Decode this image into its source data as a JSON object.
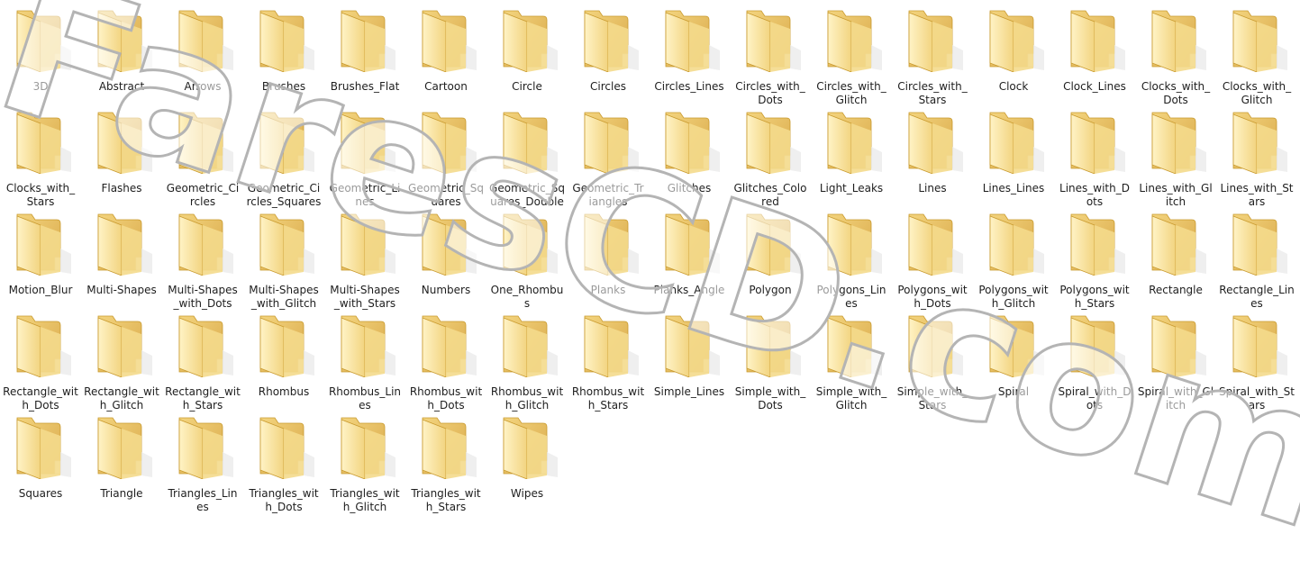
{
  "folders": [
    "3D",
    "Abstract",
    "Arrows",
    "Brushes",
    "Brushes_Flat",
    "Cartoon",
    "Circle",
    "Circles",
    "Circles_Lines",
    "Circles_with_\nDots",
    "Circles_with_\nGlitch",
    "Circles_with_\nStars",
    "Clock",
    "Clock_Lines",
    "Clocks_with_\nDots",
    "Clocks_with_\nGlitch",
    "Clocks_with_\nStars",
    "Flashes",
    "Geometric_Ci\nrcles",
    "Geometric_Ci\nrcles_Squares",
    "Geometric_Li\nnes",
    "Geometric_Sq\nuares",
    "Geometric_Sq\nuares_Double",
    "Geometric_Tr\niangles",
    "Glitches",
    "Glitches_Colo\nred",
    "Light_Leaks",
    "Lines",
    "Lines_Lines",
    "Lines_with_D\nots",
    "Lines_with_Gl\nitch",
    "Lines_with_St\nars",
    "Motion_Blur",
    "Multi-Shapes",
    "Multi-Shapes\n_with_Dots",
    "Multi-Shapes\n_with_Glitch",
    "Multi-Shapes\n_with_Stars",
    "Numbers",
    "One_Rhombu\ns",
    "Planks",
    "Planks_Angle",
    "Polygon",
    "Polygons_Lin\nes",
    "Polygons_wit\nh_Dots",
    "Polygons_wit\nh_Glitch",
    "Polygons_wit\nh_Stars",
    "Rectangle",
    "Rectangle_Lin\nes",
    "Rectangle_wit\nh_Dots",
    "Rectangle_wit\nh_Glitch",
    "Rectangle_wit\nh_Stars",
    "Rhombus",
    "Rhombus_Lin\nes",
    "Rhombus_wit\nh_Dots",
    "Rhombus_wit\nh_Glitch",
    "Rhombus_wit\nh_Stars",
    "Simple_Lines",
    "Simple_with_\nDots",
    "Simple_with_\nGlitch",
    "Simple_with_\nStars",
    "Spiral",
    "Spiral_with_D\nots",
    "Spiral_with_Gl\nitch",
    "Spiral_with_St\nars",
    "Squares",
    "Triangle",
    "Triangles_Lin\nes",
    "Triangles_wit\nh_Dots",
    "Triangles_wit\nh_Glitch",
    "Triangles_wit\nh_Stars",
    "Wipes"
  ],
  "icon": "folder-icon",
  "colors": {
    "folder_back": "#e3bd57",
    "folder_front": "#fbe9a8",
    "folder_edge": "#c99a2e"
  },
  "watermark": {
    "text": "FaresCD.com"
  }
}
